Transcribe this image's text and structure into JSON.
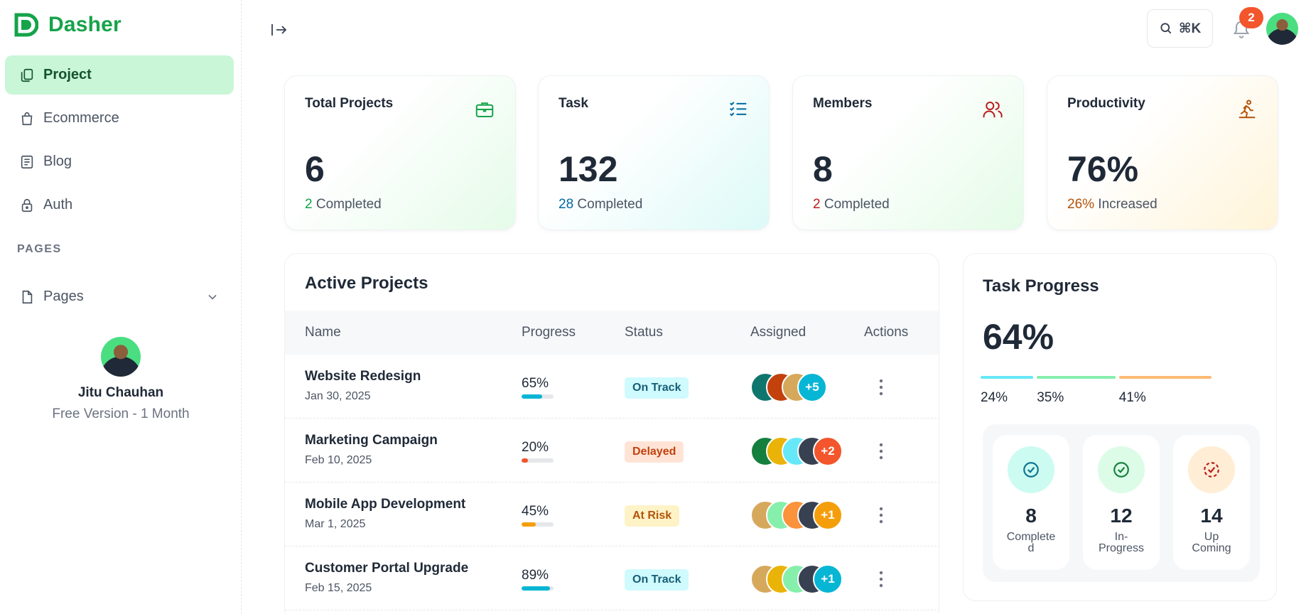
{
  "brand": {
    "name": "Dasher"
  },
  "sidebar": {
    "items": [
      {
        "label": "Project",
        "icon": "copy-icon",
        "active": true
      },
      {
        "label": "Ecommerce",
        "icon": "shopping-bag-icon",
        "active": false
      },
      {
        "label": "Blog",
        "icon": "article-icon",
        "active": false
      },
      {
        "label": "Auth",
        "icon": "lock-icon",
        "active": false
      }
    ],
    "section_label": "PAGES",
    "pages_label": "Pages",
    "profile": {
      "name": "Jitu Chauhan",
      "plan": "Free Version - 1 Month"
    }
  },
  "header": {
    "search_shortcut": "⌘K",
    "notification_count": "2"
  },
  "stats": [
    {
      "title": "Total Projects",
      "value": "6",
      "highlight": "2",
      "sub": " Completed",
      "icon": "briefcase-icon",
      "color": "#16a34a"
    },
    {
      "title": "Task",
      "value": "132",
      "highlight": "28",
      "sub": " Completed",
      "icon": "checklist-icon",
      "color": "#0369a1"
    },
    {
      "title": "Members",
      "value": "8",
      "highlight": "2",
      "sub": " Completed",
      "icon": "users-icon",
      "color": "#b91c1c"
    },
    {
      "title": "Productivity",
      "value": "76%",
      "highlight": "26%",
      "sub": " Increased",
      "icon": "run-icon",
      "color": "#b45309"
    }
  ],
  "projects": {
    "title": "Active Projects",
    "columns": [
      "Name",
      "Progress",
      "Status",
      "Assigned",
      "Actions"
    ],
    "rows": [
      {
        "name": "Website Redesign",
        "date": "Jan 30, 2025",
        "progress": "65%",
        "progress_value": 0.65,
        "bar_color": "#06b6d4",
        "status": "On Track",
        "status_bg": "#cffafe",
        "status_fg": "#155e75",
        "extra": "+5",
        "extra_color": "#06b6d4"
      },
      {
        "name": "Marketing Campaign",
        "date": "Feb 10, 2025",
        "progress": "20%",
        "progress_value": 0.2,
        "bar_color": "#f3552c",
        "status": "Delayed",
        "status_bg": "#ffe4d6",
        "status_fg": "#c2410c",
        "extra": "+2",
        "extra_color": "#f3552c"
      },
      {
        "name": "Mobile App Development",
        "date": "Mar 1, 2025",
        "progress": "45%",
        "progress_value": 0.45,
        "bar_color": "#f59e0b",
        "status": "At Risk",
        "status_bg": "#fef3c7",
        "status_fg": "#b45309",
        "extra": "+1",
        "extra_color": "#f59e0b"
      },
      {
        "name": "Customer Portal Upgrade",
        "date": "Feb 15, 2025",
        "progress": "89%",
        "progress_value": 0.89,
        "bar_color": "#06b6d4",
        "status": "On Track",
        "status_bg": "#cffafe",
        "status_fg": "#155e75",
        "extra": "+1",
        "extra_color": "#06b6d4"
      }
    ]
  },
  "task_progress": {
    "title": "Task Progress",
    "value": "64%",
    "segments": [
      {
        "label": "24%",
        "value": 0.24,
        "color": "#67e8f9"
      },
      {
        "label": "35%",
        "value": 0.35,
        "color": "#86efac"
      },
      {
        "label": "41%",
        "value": 0.41,
        "color": "#fdba74"
      }
    ],
    "cards": [
      {
        "value": "8",
        "label": "Completed",
        "bg": "#ccfbf1",
        "color": "#0e7490",
        "icon": "check-circle-icon"
      },
      {
        "value": "12",
        "label": "In-Progress",
        "bg": "#dcfce7",
        "color": "#15803d",
        "icon": "check-circle-icon"
      },
      {
        "value": "14",
        "label": "Up Coming",
        "bg": "#ffedd5",
        "color": "#b91c1c",
        "icon": "dashed-circle-icon"
      }
    ]
  }
}
